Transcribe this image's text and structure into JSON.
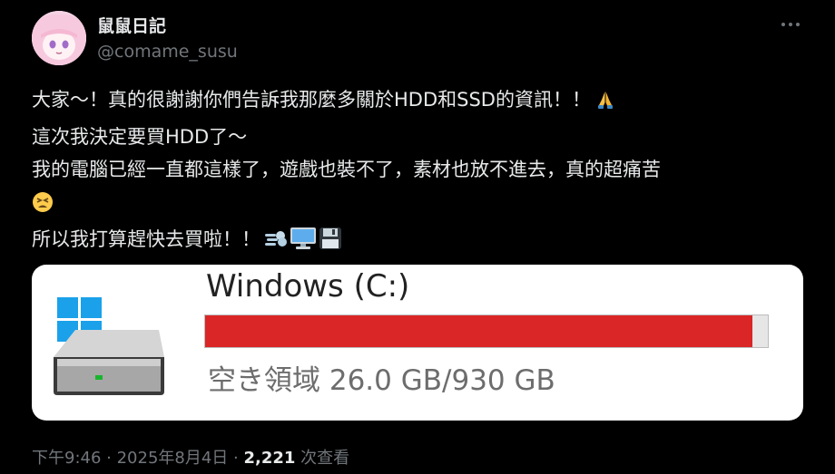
{
  "author": {
    "name": "鼠鼠日記",
    "handle": "@comame_susu"
  },
  "tweet": {
    "lines": [
      "大家〜！真的很謝謝你們告訴我那麼多關於HDD和SSD的資訊！！",
      "這次我決定要買HDD了〜",
      "我的電腦已經一直都這樣了，遊戲也裝不了，素材也放不進去，真的超痛苦",
      "",
      "所以我打算趕快去買啦！！"
    ],
    "emoji": {
      "line1": "folded-hands-emoji",
      "line4": "tired-face-emoji",
      "line5": [
        "dash-emoji",
        "desktop-computer-emoji",
        "floppy-disk-emoji"
      ]
    }
  },
  "media": {
    "drive_title": "Windows (C:)",
    "free_space": "空き領域 26.0 GB/930 GB",
    "used_fraction": 0.972,
    "bar_color": "#da2626"
  },
  "meta": {
    "time": "下午9:46",
    "separator": " · ",
    "date": "2025年8月4日",
    "views_count": "2,221",
    "views_label": " 次查看"
  }
}
